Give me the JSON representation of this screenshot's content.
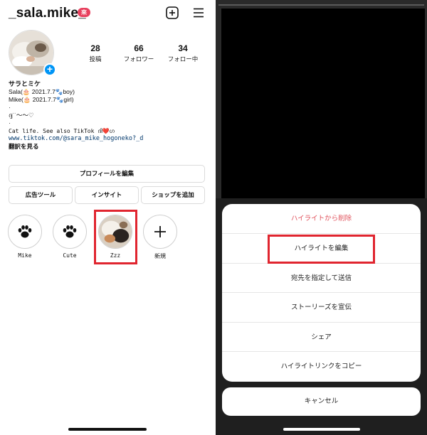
{
  "profile": {
    "username": "_sala.mike_",
    "threads_badge": "來",
    "stats": [
      {
        "value": "28",
        "label": "投稿"
      },
      {
        "value": "66",
        "label": "フォロワー"
      },
      {
        "value": "34",
        "label": "フォロー中"
      }
    ],
    "bio": {
      "name": "サラとミケ",
      "line1": "Sala(🎂 2021.7.7🐾boy)",
      "line2": "Mike(🎂 2021.7.7🐾girl)",
      "dot1": "·",
      "line3": "ദ്ദ˙˙〜〜♡",
      "dot2": "·",
      "line4": "Cat life. See also TikTok ദി❤️ഗ",
      "link": "www.tiktok.com/@sara_mike_hogoneko?_d",
      "translate": "翻訳を見る"
    },
    "buttons": {
      "edit_profile": "プロフィールを編集",
      "ad_tools": "広告ツール",
      "insights": "インサイト",
      "add_shop": "ショップを追加"
    },
    "highlights": [
      {
        "label": "Mike"
      },
      {
        "label": "Cute"
      },
      {
        "label": "Zzz"
      },
      {
        "label": "新規"
      }
    ]
  },
  "sheet": {
    "items": [
      "ハイライトから削除",
      "ハイライトを編集",
      "宛先を指定して送信",
      "ストーリーズを宣伝",
      "シェア",
      "ハイライトリンクをコピー"
    ],
    "cancel": "キャンセル"
  },
  "colors": {
    "accent_blue": "#0095f6",
    "highlight_box_red": "#e0252f",
    "danger_text": "#e0525c",
    "link_blue": "#00376b"
  }
}
